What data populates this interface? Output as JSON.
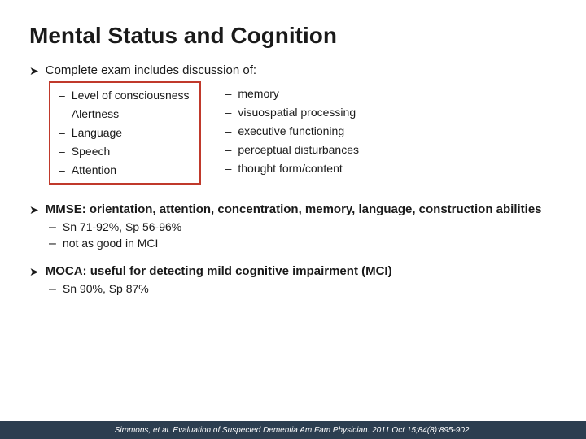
{
  "title": "Mental Status and Cognition",
  "section1": {
    "bullet": "Complete exam includes discussion of:",
    "col_left": [
      "Level of consciousness",
      "Alertness",
      "Language",
      "Speech",
      "Attention"
    ],
    "col_right": [
      "memory",
      "visuospatial processing",
      "executive functioning",
      "perceptual disturbances",
      "thought form/content"
    ]
  },
  "section2": {
    "bullet": "MMSE: orientation, attention, concentration, memory, language, construction abilities",
    "sub_items": [
      "Sn 71-92%, Sp 56-96%",
      "not as good in MCI"
    ]
  },
  "section3": {
    "bullet": "MOCA: useful for detecting mild cognitive impairment (MCI)",
    "sub_items": [
      "Sn 90%, Sp 87%"
    ]
  },
  "footer": "Simmons, et al. Evaluation of Suspected Dementia Am Fam Physician. 2011 Oct 15;84(8):895-902.",
  "arrow_symbol": "➤",
  "dash_symbol": "–"
}
